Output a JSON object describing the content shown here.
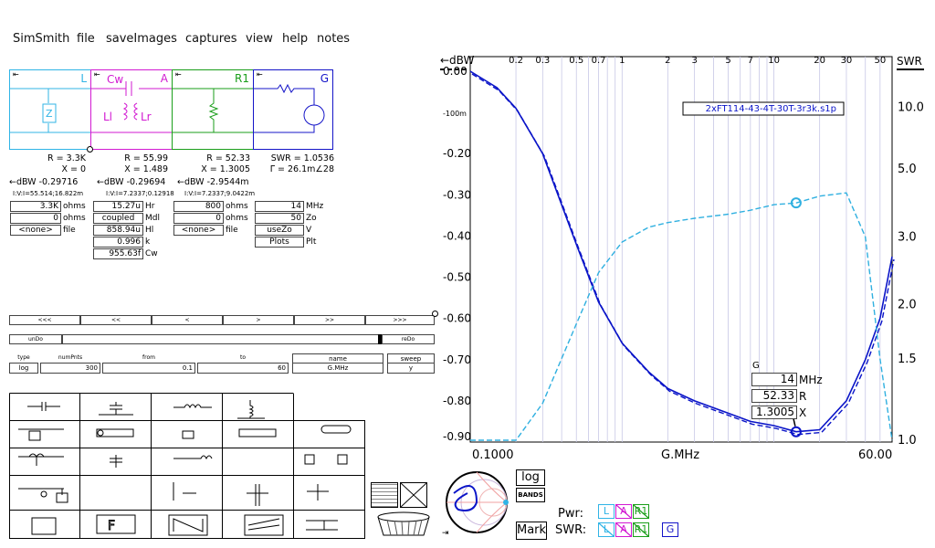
{
  "app": {
    "menu": [
      "SimSmith",
      "file",
      "saveImages",
      "captures",
      "view",
      "help",
      "notes"
    ]
  },
  "blocks": {
    "L": {
      "label": "L",
      "R": "R = 3.3K",
      "X": "X = 0",
      "dbw": "←dBW -0.29716",
      "vi": "I:V:I=55.514;16.822m",
      "fields": [
        "3.3K",
        "0",
        "<none>"
      ],
      "units": [
        "ohms",
        "ohms",
        "file"
      ]
    },
    "A": {
      "label": "A",
      "sub_cw": "Cw",
      "sub_ll": "Ll",
      "sub_lr": "Lr",
      "R": "R = 55.99",
      "X": "X = 1.489",
      "dbw": "←dBW -0.29694",
      "vi": "I:V:I=7.2337;0.12918",
      "fields": [
        "15.27u",
        "coupled",
        "858.94u",
        "0.996",
        "955.63f"
      ],
      "units": [
        "Hr",
        "Mdl",
        "Hl",
        "k",
        "Cw"
      ]
    },
    "R1": {
      "label": "R1",
      "R": "R = 52.33",
      "X": "X = 1.3005",
      "dbw": "←dBW -2.9544m",
      "vi": "I:V:I=7.2337;9.0422m",
      "fields": [
        "800",
        "0",
        "<none>"
      ],
      "units": [
        "ohms",
        "ohms",
        "file"
      ]
    },
    "G": {
      "label": "G",
      "swr": "SWR = 1.0536",
      "gamma": "Γ = 26.1m∠28",
      "fields": [
        "14",
        "50",
        "useZo",
        "Plots"
      ],
      "units": [
        "MHz",
        "Zo",
        "V",
        "Plt"
      ]
    }
  },
  "nav": {
    "buttons": [
      "<<<",
      "<<",
      "<",
      ">",
      ">>",
      ">>>"
    ],
    "undo": "unDo",
    "redo": "reDo"
  },
  "sweep": {
    "headers": [
      "type",
      "numPnts",
      "from",
      "to",
      "name",
      "sweep"
    ],
    "values": [
      "log",
      "300",
      "0.1",
      "60",
      "G.MHz",
      "y"
    ]
  },
  "chart": {
    "ylabel_left": "←dBW",
    "ylabel_right": "SWR",
    "left_ticks": [
      "0.00",
      "-100m",
      "-0.20",
      "-0.30",
      "-0.40",
      "-0.50",
      "-0.60",
      "-0.70",
      "-0.80",
      "-0.90"
    ],
    "right_ticks": [
      "10.0",
      "5.0",
      "3.0",
      "2.0",
      "1.5",
      "1.0"
    ],
    "top_ticks": [
      "0.2",
      "0.3",
      "0.5",
      "0.7",
      "1",
      "2",
      "3",
      "5",
      "7",
      "10",
      "20",
      "30",
      "50"
    ],
    "x_start": "0.1000",
    "x_name": "G.MHz",
    "x_end": "60.00",
    "file_label": "2xFT114-43-4T-30T-3r3k.s1p",
    "cursor": {
      "title": "G",
      "values": [
        "14",
        "52.33",
        "1.3005"
      ],
      "units": [
        "MHz",
        "R",
        "X"
      ]
    }
  },
  "chart_data": {
    "type": "line",
    "xscale": "log",
    "xlim": [
      0.1,
      60
    ],
    "ylim_left": [
      -0.9,
      0.0
    ],
    "x": [
      0.1,
      0.15,
      0.2,
      0.3,
      0.5,
      0.7,
      1,
      1.5,
      2,
      3,
      5,
      7,
      10,
      14,
      20,
      30,
      40,
      50,
      60
    ],
    "series": [
      {
        "name": "dBW",
        "axis": "left",
        "values": [
          0.0,
          -0.04,
          -0.09,
          -0.2,
          -0.42,
          -0.56,
          -0.66,
          -0.73,
          -0.77,
          -0.8,
          -0.83,
          -0.85,
          -0.86,
          -0.875,
          -0.87,
          -0.8,
          -0.7,
          -0.6,
          -0.45
        ]
      },
      {
        "name": "SWR",
        "axis": "right",
        "values": [
          1.0,
          1.0,
          1.0,
          1.2,
          1.8,
          2.4,
          2.9,
          3.2,
          3.3,
          3.4,
          3.5,
          3.6,
          3.75,
          3.8,
          4.0,
          4.1,
          3.0,
          1.5,
          1.0
        ]
      }
    ],
    "marker": {
      "x": 14
    }
  },
  "bottom": {
    "log_btn": "log",
    "bands_btn": "BANDS",
    "mark_btn": "Mark",
    "pwr_label": "Pwr:",
    "swr_label": "SWR:",
    "pwr_boxes": [
      "L",
      "A",
      "R1"
    ],
    "swr_boxes": [
      "L",
      "A",
      "R1",
      "G"
    ]
  },
  "colors": {
    "dbw": "#0a14c8",
    "swr": "#30b0e0",
    "L": "#30b4e6",
    "A": "#d21ad2",
    "R1": "#1a9e1a",
    "G": "#1414c8"
  }
}
